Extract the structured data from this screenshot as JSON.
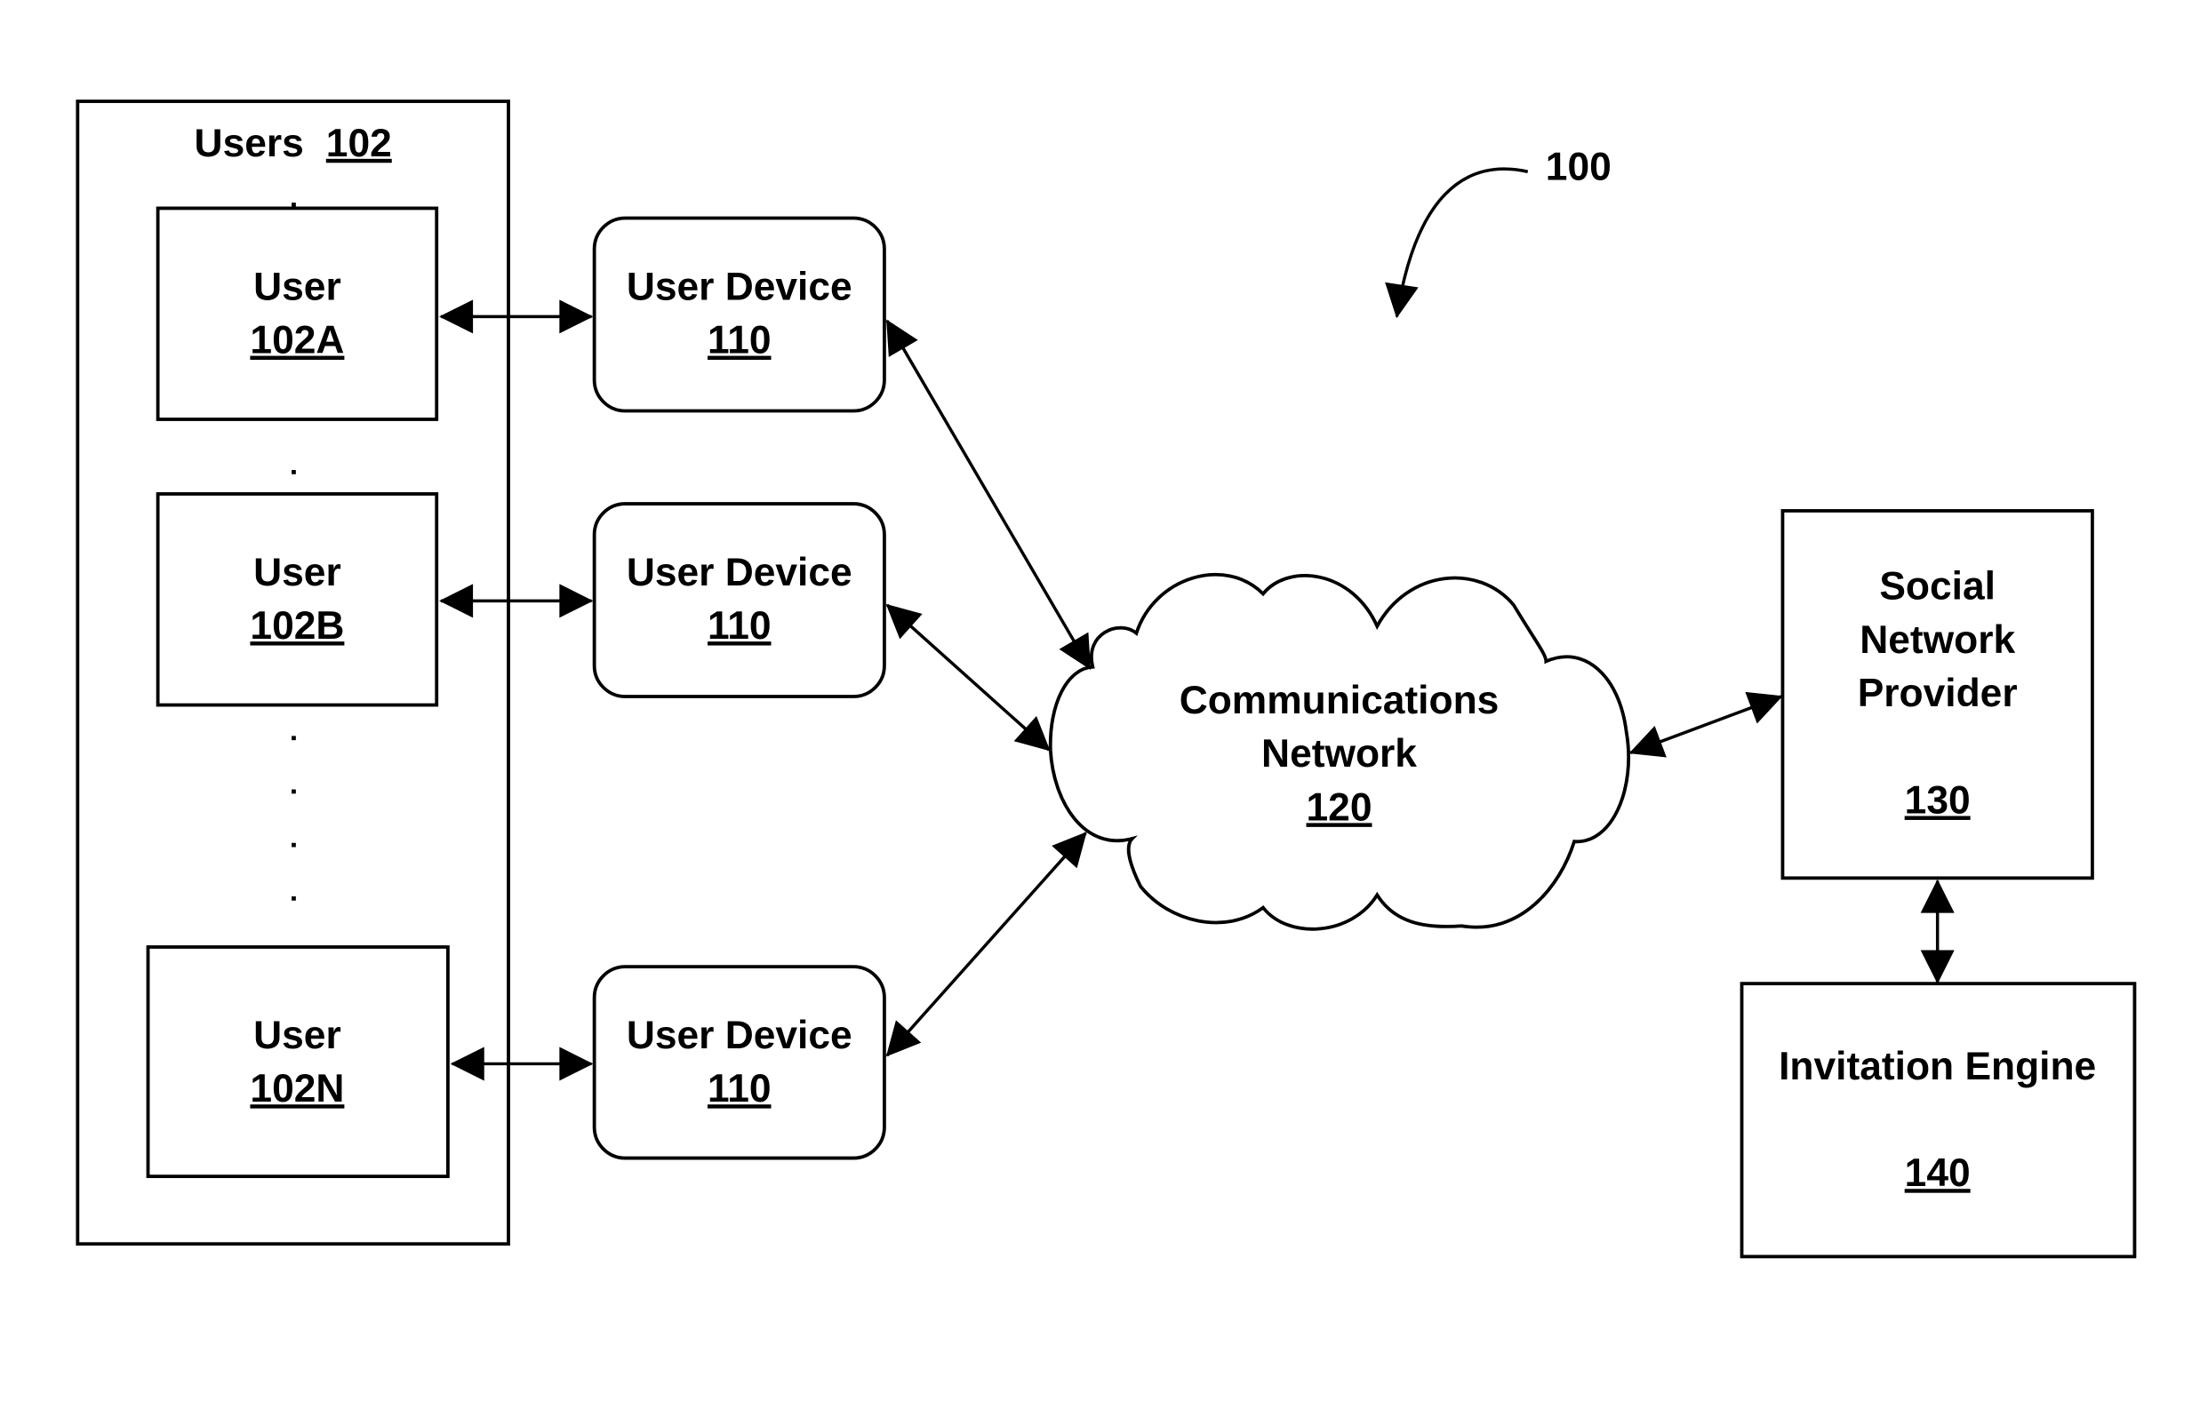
{
  "figure": {
    "reference": "100",
    "colors": {
      "stroke": "#000000",
      "background": "#ffffff"
    }
  },
  "users_group": {
    "title": "Users",
    "ref": "102"
  },
  "users": [
    {
      "label": "User",
      "ref": "102A"
    },
    {
      "label": "User",
      "ref": "102B"
    },
    {
      "label": "User",
      "ref": "102N"
    }
  ],
  "user_devices": [
    {
      "label": "User Device",
      "ref": "110"
    },
    {
      "label": "User Device",
      "ref": "110"
    },
    {
      "label": "User Device",
      "ref": "110"
    }
  ],
  "network": {
    "line1": "Communications",
    "line2": "Network",
    "ref": "120"
  },
  "social_network_provider": {
    "line1": "Social",
    "line2": "Network",
    "line3": "Provider",
    "ref": "130"
  },
  "invitation_engine": {
    "label": "Invitation Engine",
    "ref": "140"
  },
  "connections": [
    {
      "from": "User 102A",
      "to": "User Device 110",
      "type": "bidirectional"
    },
    {
      "from": "User 102B",
      "to": "User Device 110",
      "type": "bidirectional"
    },
    {
      "from": "User 102N",
      "to": "User Device 110",
      "type": "bidirectional"
    },
    {
      "from": "User Device 110",
      "to": "Communications Network 120",
      "type": "bidirectional"
    },
    {
      "from": "User Device 110",
      "to": "Communications Network 120",
      "type": "bidirectional"
    },
    {
      "from": "User Device 110",
      "to": "Communications Network 120",
      "type": "bidirectional"
    },
    {
      "from": "Communications Network 120",
      "to": "Social Network Provider 130",
      "type": "bidirectional"
    },
    {
      "from": "Social Network Provider 130",
      "to": "Invitation Engine 140",
      "type": "bidirectional"
    }
  ]
}
